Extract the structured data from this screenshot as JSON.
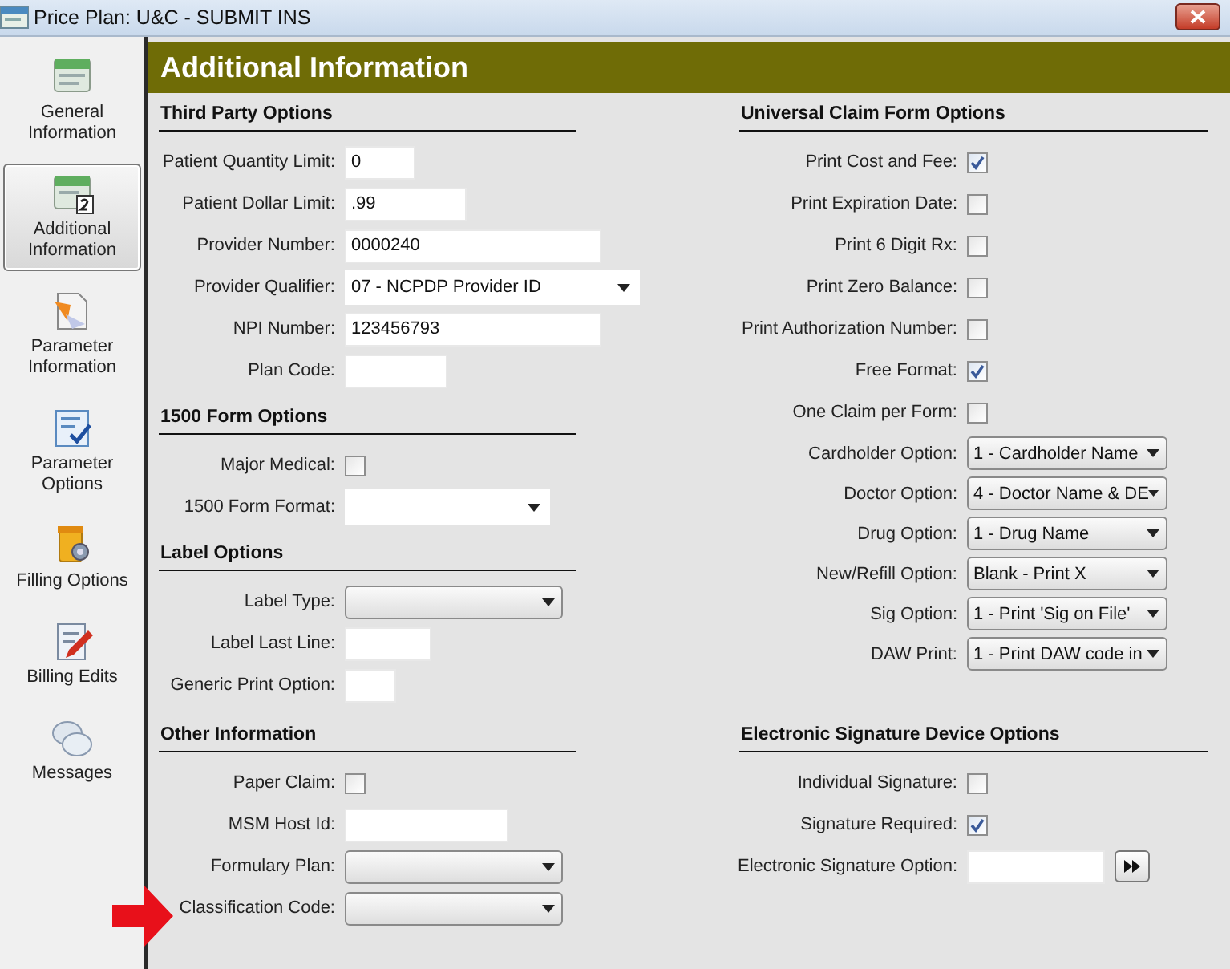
{
  "window": {
    "title": "Price Plan: U&C - SUBMIT INS"
  },
  "sidebar": {
    "items": [
      {
        "label": "General Information",
        "kind": "general",
        "selected": false
      },
      {
        "label": "Additional Information",
        "kind": "additional",
        "selected": true
      },
      {
        "label": "Parameter Information",
        "kind": "parameter",
        "selected": false
      },
      {
        "label": "Parameter Options",
        "kind": "options",
        "selected": false
      },
      {
        "label": "Filling Options",
        "kind": "filling",
        "selected": false
      },
      {
        "label": "Billing Edits",
        "kind": "billing",
        "selected": false
      },
      {
        "label": "Messages",
        "kind": "messages",
        "selected": false
      }
    ]
  },
  "header": {
    "title": "Additional Information"
  },
  "columns": [
    {
      "sections": [
        {
          "title": "Third Party Options",
          "fields": [
            {
              "label": "Patient Quantity Limit:",
              "kind": "text",
              "value": "0"
            },
            {
              "label": "Patient Dollar Limit:",
              "kind": "text",
              "value": ".99"
            },
            {
              "label": "Provider Number:",
              "kind": "text",
              "value": "0000240"
            },
            {
              "label": "Provider Qualifier:",
              "kind": "dropdown",
              "value": "07 - NCPDP Provider ID"
            },
            {
              "label": "NPI Number:",
              "kind": "text",
              "value": "123456793"
            },
            {
              "label": "Plan Code:",
              "kind": "text"
            }
          ]
        },
        {
          "title": "1500 Form Options",
          "fields": [
            {
              "label": "Major Medical:",
              "kind": "checkbox",
              "checked": false
            },
            {
              "label": "1500 Form Format:",
              "kind": "dropdown"
            }
          ]
        },
        {
          "title": "Label Options",
          "fields": [
            {
              "label": "Label Type:",
              "kind": "combo"
            },
            {
              "label": "Label Last Line:",
              "kind": "text"
            },
            {
              "label": "Generic Print Option:",
              "kind": "text"
            }
          ]
        },
        {
          "title": "Other Information",
          "fields": [
            {
              "label": "Paper Claim:",
              "kind": "checkbox",
              "checked": false
            },
            {
              "label": "MSM Host Id:",
              "kind": "text"
            },
            {
              "label": "Formulary Plan:",
              "kind": "combo"
            },
            {
              "label": "Classification Code:",
              "kind": "combo"
            }
          ]
        }
      ]
    },
    {
      "sections": [
        {
          "title": "Universal Claim Form Options",
          "fields": [
            {
              "label": "Print Cost and Fee:",
              "kind": "checkbox",
              "checked": true
            },
            {
              "label": "Print Expiration Date:",
              "kind": "checkbox",
              "checked": false
            },
            {
              "label": "Print 6 Digit Rx:",
              "kind": "checkbox",
              "checked": false
            },
            {
              "label": "Print Zero Balance:",
              "kind": "checkbox",
              "checked": false
            },
            {
              "label": "Print Authorization Number:",
              "kind": "checkbox",
              "checked": false
            },
            {
              "label": "Free Format:",
              "kind": "checkbox",
              "checked": true
            },
            {
              "label": "One Claim per Form:",
              "kind": "checkbox",
              "checked": false
            },
            {
              "label": "Cardholder Option:",
              "kind": "combo",
              "value": "1 - Cardholder Name"
            },
            {
              "label": "Doctor Option:",
              "kind": "combo",
              "value": "4 - Doctor Name & DE"
            },
            {
              "label": "Drug Option:",
              "kind": "combo",
              "value": "1 - Drug Name"
            },
            {
              "label": "New/Refill Option:",
              "kind": "combo",
              "value": "Blank - Print X"
            },
            {
              "label": "Sig Option:",
              "kind": "combo",
              "value": "1 - Print 'Sig on File'"
            },
            {
              "label": "DAW Print:",
              "kind": "combo",
              "value": "1 - Print DAW code in"
            }
          ]
        },
        {
          "title": "Electronic Signature Device Options",
          "fields": [
            {
              "label": "Individual Signature:",
              "kind": "checkbox",
              "checked": false
            },
            {
              "label": "Signature Required:",
              "kind": "checkbox",
              "checked": true
            },
            {
              "label": "Electronic Signature Option:",
              "kind": "text-button"
            }
          ]
        }
      ]
    }
  ]
}
